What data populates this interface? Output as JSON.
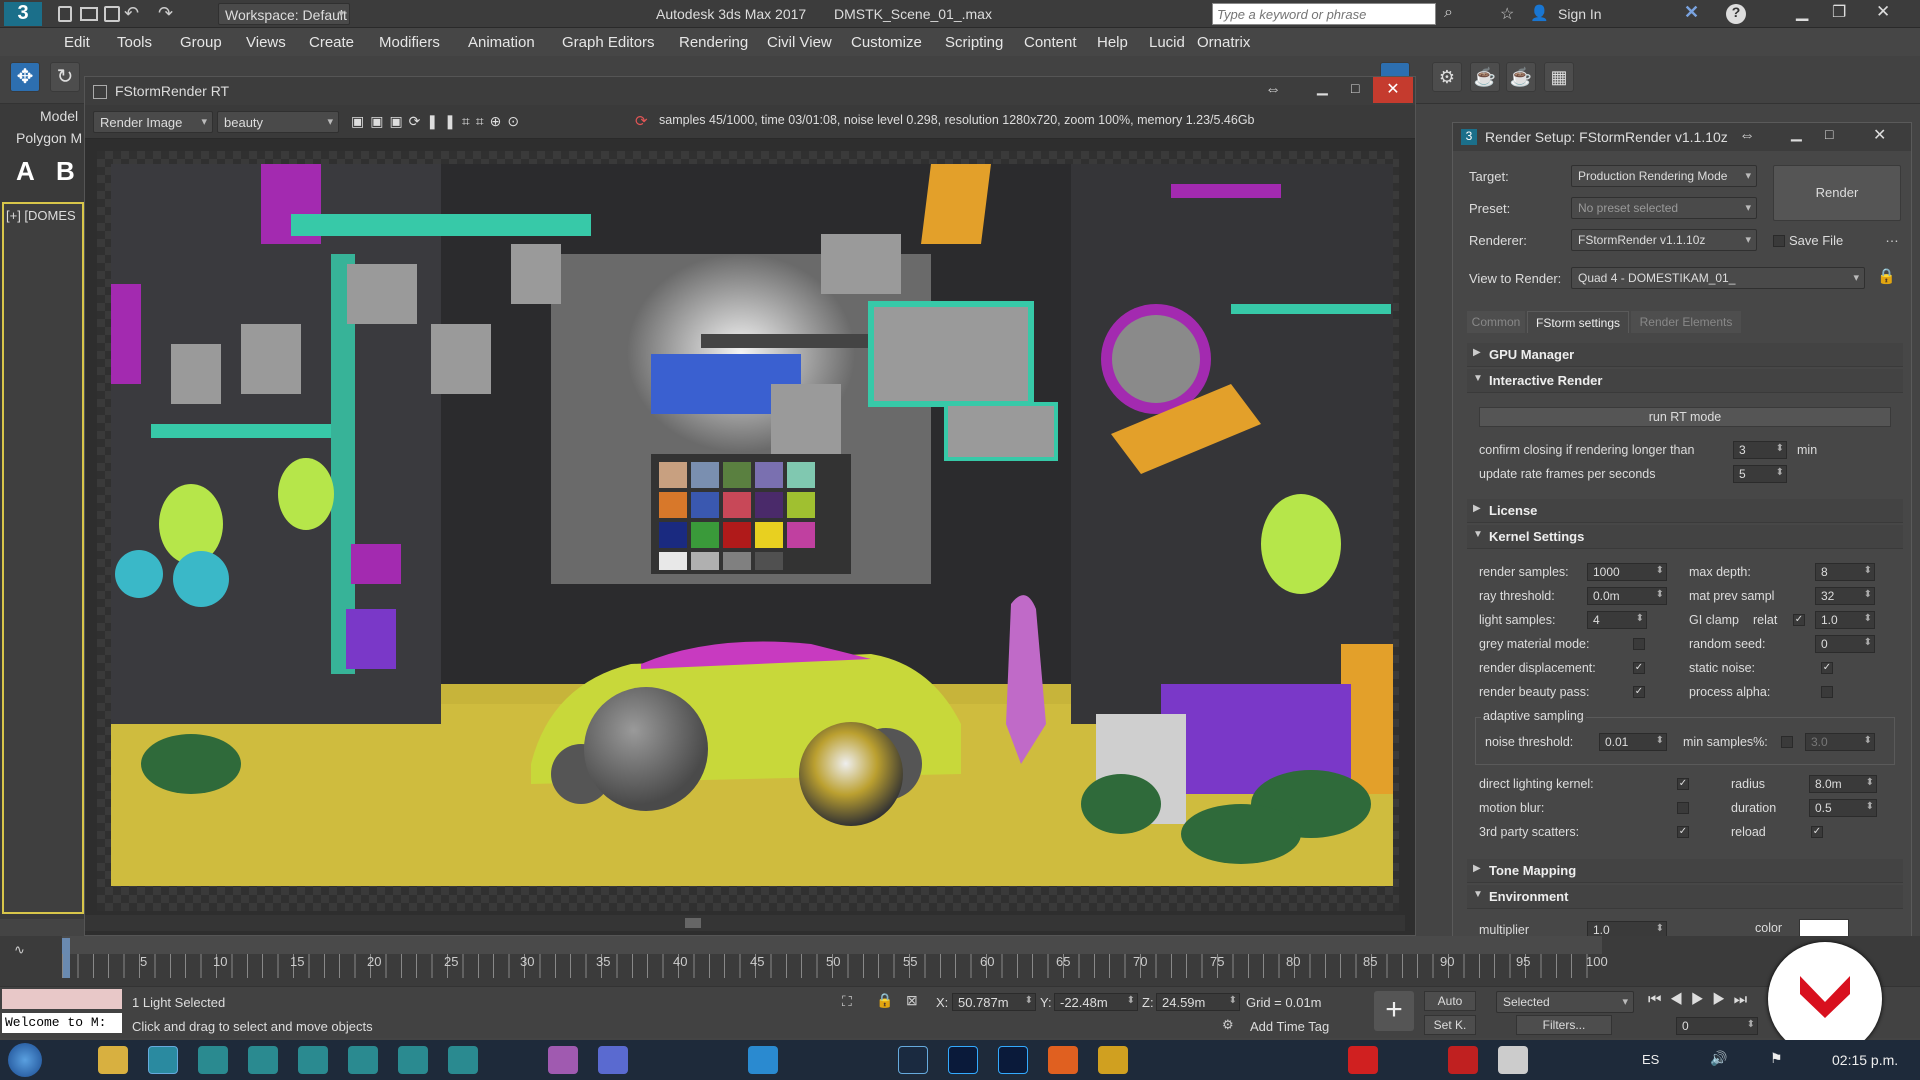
{
  "titlebar": {
    "workspace": "Workspace: Default",
    "app_title": "Autodesk 3ds Max 2017",
    "file_title": "DMSTK_Scene_01_.max",
    "search_placeholder": "Type a keyword or phrase",
    "sign_in": "Sign In"
  },
  "menu": [
    "Edit",
    "Tools",
    "Group",
    "Views",
    "Create",
    "Modifiers",
    "Animation",
    "Graph Editors",
    "Rendering",
    "Civil View",
    "Customize",
    "Scripting",
    "Content",
    "Help",
    "Lucid",
    "Ornatrix"
  ],
  "left": {
    "tab": "Model",
    "sub": "Polygon M",
    "viewport_label": "[+] [DOMES"
  },
  "rt": {
    "title": "FStormRender RT",
    "channel": "Render Image",
    "pass": "beauty",
    "status": "samples 45/1000,  time 03/01:08,  noise level 0.298,  resolution 1280x720,  zoom 100%,  memory 1.23/5.46Gb"
  },
  "rs": {
    "title": "Render Setup: FStormRender v1.1.10z",
    "target_label": "Target:",
    "target": "Production Rendering Mode",
    "preset_label": "Preset:",
    "preset": "No preset selected",
    "renderer_label": "Renderer:",
    "renderer": "FStormRender v1.1.10z",
    "save_file": "Save File",
    "view_label": "View to Render:",
    "view": "Quad 4 - DOMESTIKAM_01_",
    "render_btn": "Render",
    "tabs": [
      "Common",
      "FStorm settings",
      "Render Elements"
    ],
    "sections": {
      "gpu": "GPU Manager",
      "ir": "Interactive Render",
      "license": "License",
      "kernel": "Kernel Settings",
      "tone": "Tone Mapping",
      "env": "Environment"
    },
    "ir": {
      "run": "run RT mode",
      "confirm": "confirm closing if rendering longer than",
      "confirm_val": "3",
      "min": "min",
      "update": "update rate frames per seconds",
      "update_val": "5"
    },
    "kernel": {
      "render_samples": "render samples:",
      "render_samples_v": "1000",
      "ray_threshold": "ray threshold:",
      "ray_threshold_v": "0.0m",
      "light_samples": "light samples:",
      "light_samples_v": "4",
      "grey_material": "grey material mode:",
      "render_disp": "render displacement:",
      "render_beauty": "render beauty pass:",
      "max_depth": "max depth:",
      "max_depth_v": "8",
      "mat_prev": "mat prev sampl",
      "mat_prev_v": "32",
      "gi_clamp": "GI clamp",
      "relat": "relat",
      "gi_clamp_v": "1.0",
      "random_seed": "random seed:",
      "random_seed_v": "0",
      "static_noise": "static noise:",
      "process_alpha": "process alpha:",
      "adaptive": "adaptive sampling",
      "noise_threshold": "noise threshold:",
      "noise_threshold_v": "0.01",
      "min_samples": "min samples%:",
      "min_samples_v": "3.0",
      "direct_light": "direct lighting kernel:",
      "motion_blur": "motion blur:",
      "third_party": "3rd party scatters:",
      "radius": "radius",
      "radius_v": "8.0m",
      "duration": "duration",
      "duration_v": "0.5",
      "reload": "reload"
    },
    "env": {
      "multiplier": "multiplier",
      "multiplier_v": "1.0",
      "color": "color"
    }
  },
  "timeline": {
    "ticks": [
      "5",
      "10",
      "15",
      "20",
      "25",
      "30",
      "35",
      "40",
      "45",
      "50",
      "55",
      "60",
      "65",
      "70",
      "75",
      "80",
      "85",
      "90",
      "95",
      "100"
    ]
  },
  "status": {
    "selected": "1 Light Selected",
    "hint": "Click and drag to select and move objects",
    "welcome": "Welcome to M:",
    "x_label": "X:",
    "x": "50.787m",
    "y_label": "Y:",
    "y": "-22.48m",
    "z_label": "Z:",
    "z": "24.59m",
    "grid": "Grid = 0.01m",
    "auto": "Auto",
    "selected_dd": "Selected",
    "setk": "Set K.",
    "filters": "Filters...",
    "add_time_tag": "Add Time Tag",
    "frame": "0"
  },
  "taskbar": {
    "lang": "ES",
    "time": "02:15 p.m."
  }
}
